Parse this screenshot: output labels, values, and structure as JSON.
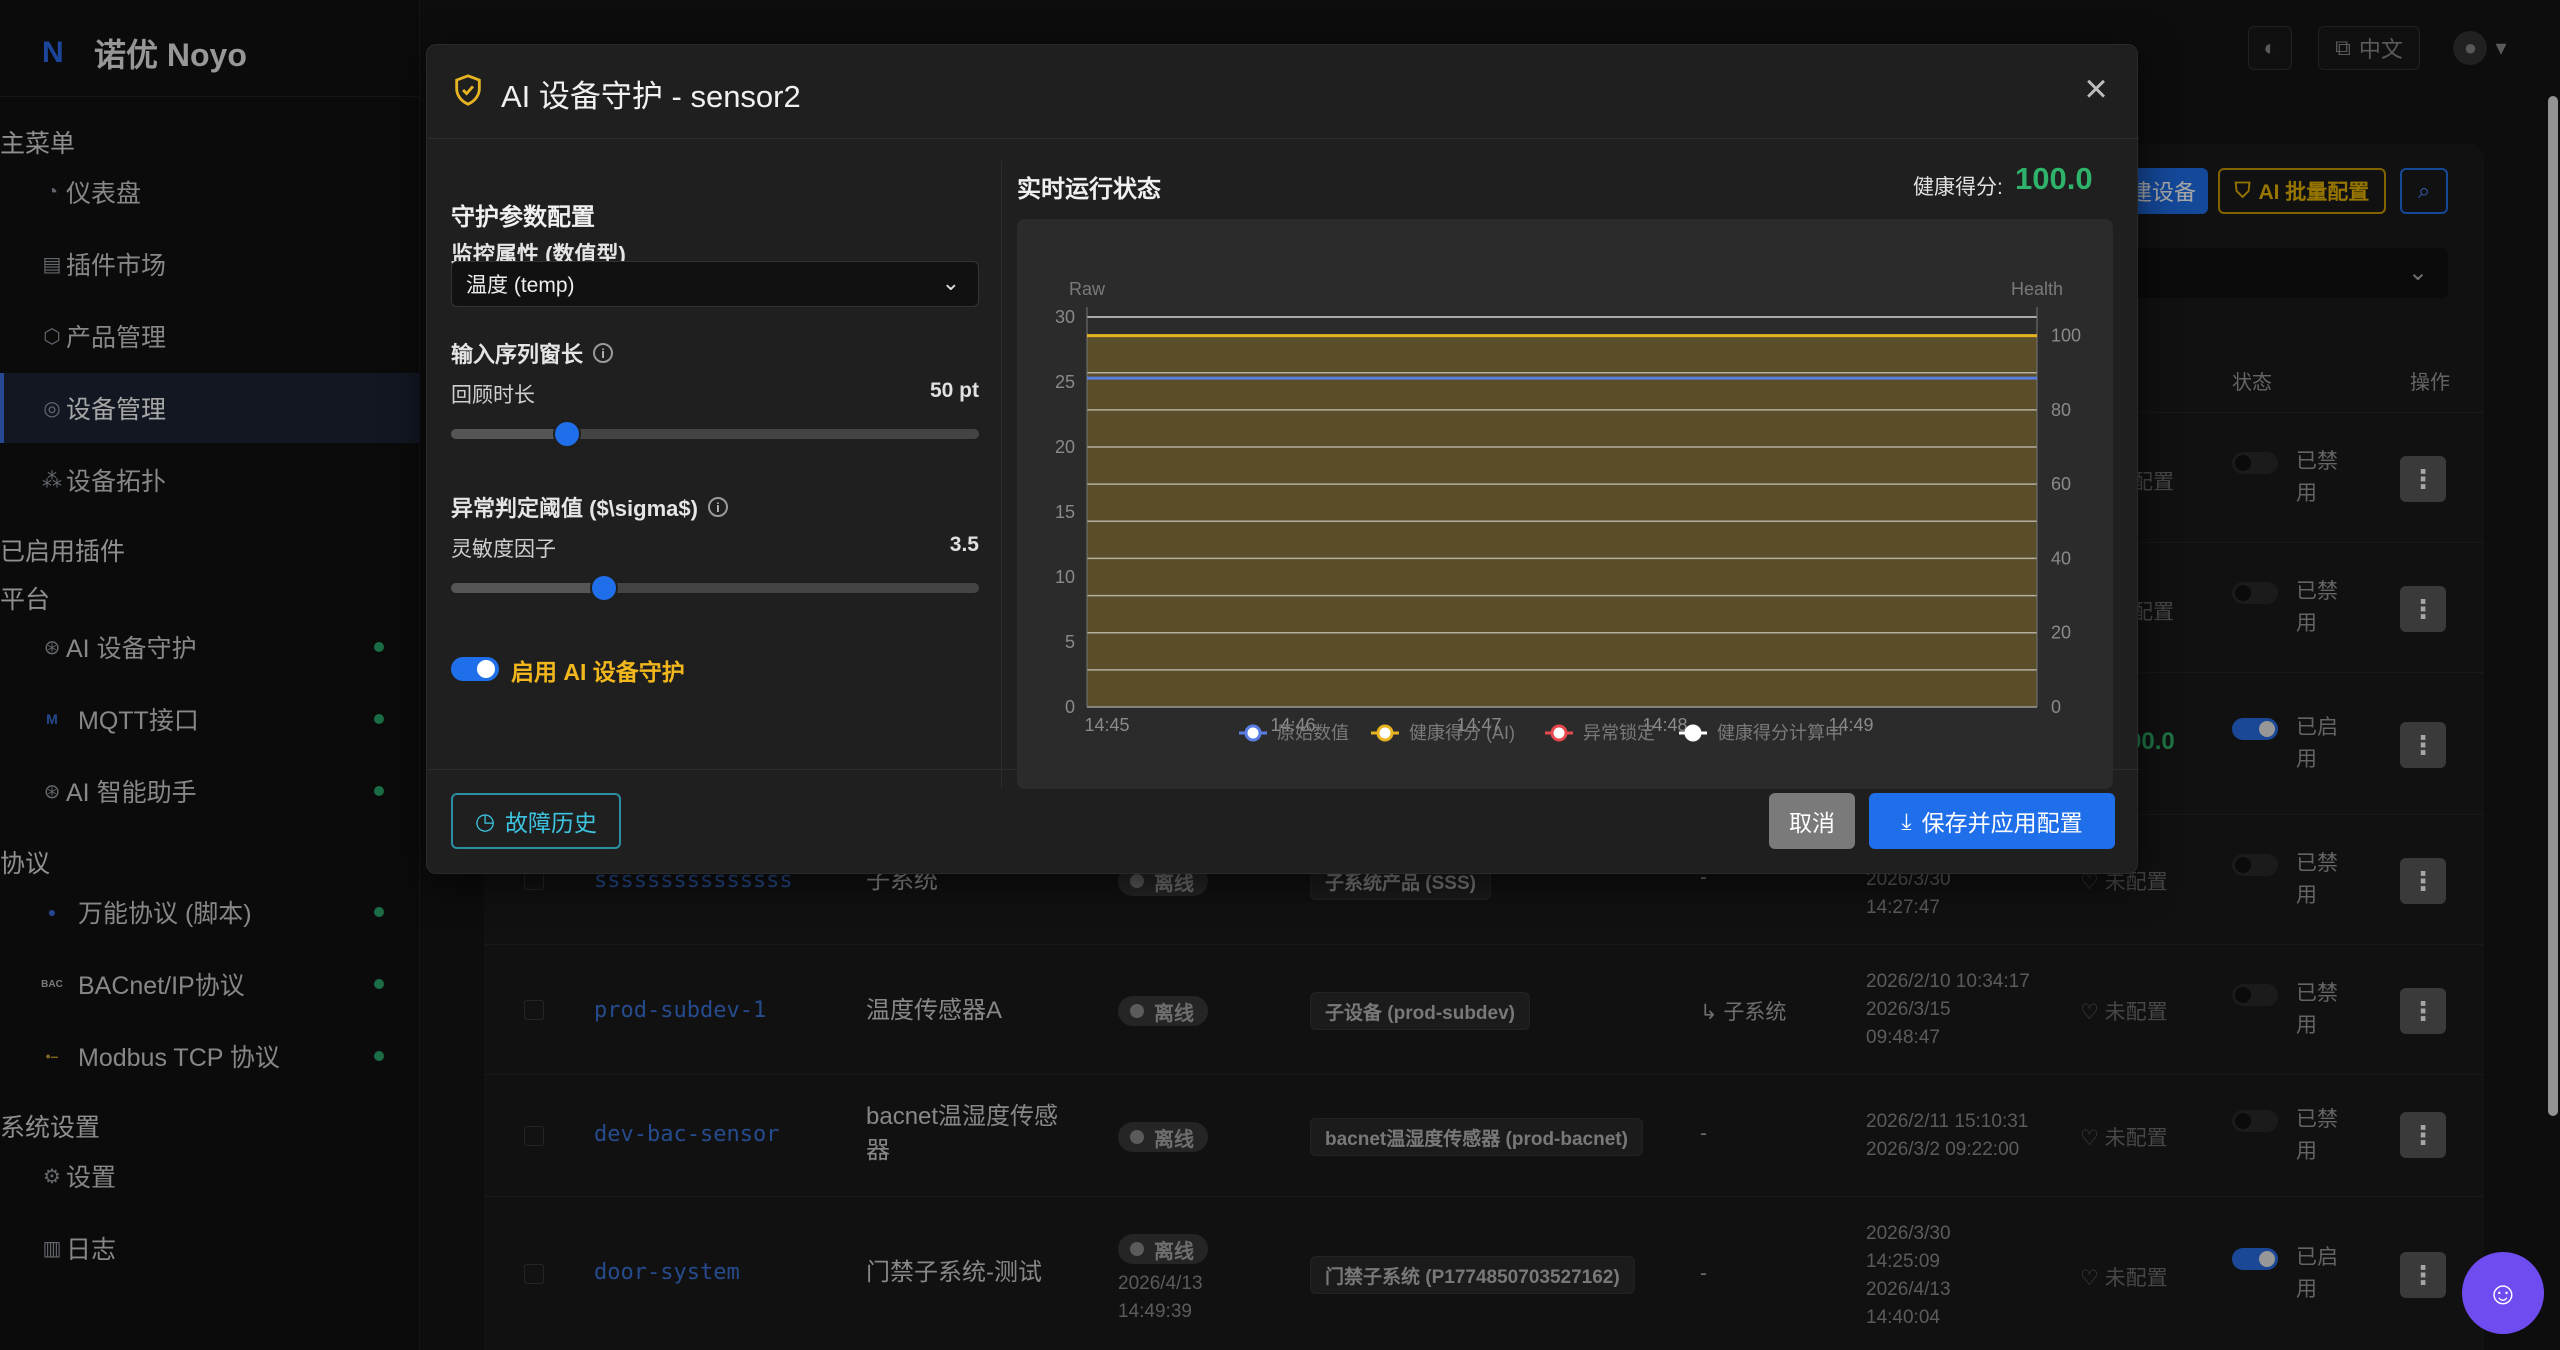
{
  "app": {
    "logo_text": "诺优 Noyo",
    "logo_mark": "N"
  },
  "topbar": {
    "lang": "中文"
  },
  "sidebar": {
    "main_menu": "主菜单",
    "main_items": [
      {
        "label": "仪表盘",
        "icon": "dashboard-icon"
      },
      {
        "label": "插件市场",
        "icon": "store-icon"
      },
      {
        "label": "产品管理",
        "icon": "box-icon"
      },
      {
        "label": "设备管理",
        "icon": "device-icon"
      },
      {
        "label": "设备拓扑",
        "icon": "topology-icon"
      }
    ],
    "plugins_heading": "已启用插件",
    "platform_heading": "平台",
    "platform_items": [
      "AI 设备守护",
      "MQTT接口",
      "AI 智能助手"
    ],
    "protocol_heading": "协议",
    "protocol_items": [
      "万能协议 (脚本)",
      "BACnet/IP协议",
      "Modbus TCP 协议"
    ],
    "settings_heading": "系统设置",
    "settings_items": [
      "设置",
      "日志"
    ]
  },
  "toolbar": {
    "create_device": "建设备",
    "ai_batch": "AI 批量配置"
  },
  "table": {
    "headers": {
      "status": "状态",
      "actions": "操作"
    },
    "rows": [
      {
        "state": "已禁\n用",
        "ai": "配置"
      },
      {
        "state": "已禁\n用",
        "ai": "配置"
      },
      {
        "state": "已启\n用",
        "score": "00.0"
      },
      {
        "id": "sssssssssssssss",
        "name": "子系统",
        "status": "离线",
        "product": "子系统产品 (SSS)",
        "parent": "-",
        "t1": "2026/3/30",
        "t2": "14:27:47",
        "ai": "未配置",
        "state": "已禁\n用"
      },
      {
        "id": "prod-subdev-1",
        "name": "温度传感器A",
        "status": "离线",
        "product": "子设备 (prod-subdev)",
        "parent": "↳ 子系统",
        "t1": "2026/2/10 10:34:17",
        "t2": "2026/3/15",
        "t3": "09:48:47",
        "ai": "未配置",
        "state": "已禁\n用"
      },
      {
        "id": "dev-bac-sensor",
        "name": "bacnet温湿度传感\n器",
        "status": "离线",
        "product": "bacnet温湿度传感器 (prod-bacnet)",
        "parent": "-",
        "t1": "2026/2/11 15:10:31",
        "t2": "2026/3/2 09:22:00",
        "ai": "未配置",
        "state": "已禁\n用"
      },
      {
        "id": "door-system",
        "name": "门禁子系统-测试",
        "status": "离线",
        "status_time1": "2026/4/13",
        "status_time2": "14:49:39",
        "product": "门禁子系统 (P1774850703527162)",
        "parent": "-",
        "t1": "2026/3/30",
        "t2": "14:25:09",
        "t3": "2026/4/13",
        "t4": "14:40:04",
        "ai": "未配置",
        "state": "已启\n用"
      }
    ]
  },
  "modal": {
    "title": "AI 设备守护 - sensor2",
    "config_title": "守护参数配置",
    "monitor_label": "监控属性 (数值型)",
    "monitor_value": "温度 (temp)",
    "window_label": "输入序列窗长",
    "lookback_label": "回顾时长",
    "lookback_value": "50 pt",
    "lookback_fraction": 0.22,
    "threshold_label": "异常判定阈值 ($\\sigma$)",
    "sensitivity_label": "灵敏度因子",
    "sensitivity_value": "3.5",
    "sensitivity_fraction": 0.29,
    "enable_label": "启用 AI 设备守护",
    "status_title": "实时运行状态",
    "health_label": "健康得分:",
    "health_score": "100.0",
    "history_button": "故障历史",
    "cancel_button": "取消",
    "save_button": "保存并应用配置"
  },
  "chart_data": {
    "type": "line",
    "y_left_label": "Raw",
    "y_right_label": "Health",
    "x": [
      "14:45",
      "14:46",
      "14:47",
      "14:48",
      "14:49"
    ],
    "y_left_ticks": [
      0,
      5,
      10,
      15,
      20,
      25,
      30
    ],
    "y_right_ticks": [
      0,
      20,
      40,
      60,
      80,
      100
    ],
    "ylim_left": [
      0,
      30
    ],
    "ylim_right": [
      0,
      105
    ],
    "series": [
      {
        "name": "原始数值",
        "axis": "left",
        "color": "#5b7ee5",
        "values": [
          25.3,
          25.3,
          25.3,
          25.3,
          25.3
        ]
      },
      {
        "name": "健康得分 (AI)",
        "axis": "right",
        "color": "#e6b422",
        "area": true,
        "values": [
          100,
          100,
          100,
          100,
          100
        ]
      },
      {
        "name": "异常锁定",
        "axis": "right",
        "color": "#e5484d",
        "values": []
      },
      {
        "name": "健康得分计算中",
        "axis": "right",
        "color": "#ffffff",
        "values": []
      }
    ],
    "legend_position": "bottom",
    "grid": true
  },
  "colors": {
    "accent": "#1f6feb",
    "success": "#2fb26a",
    "warning": "#e6b422"
  }
}
